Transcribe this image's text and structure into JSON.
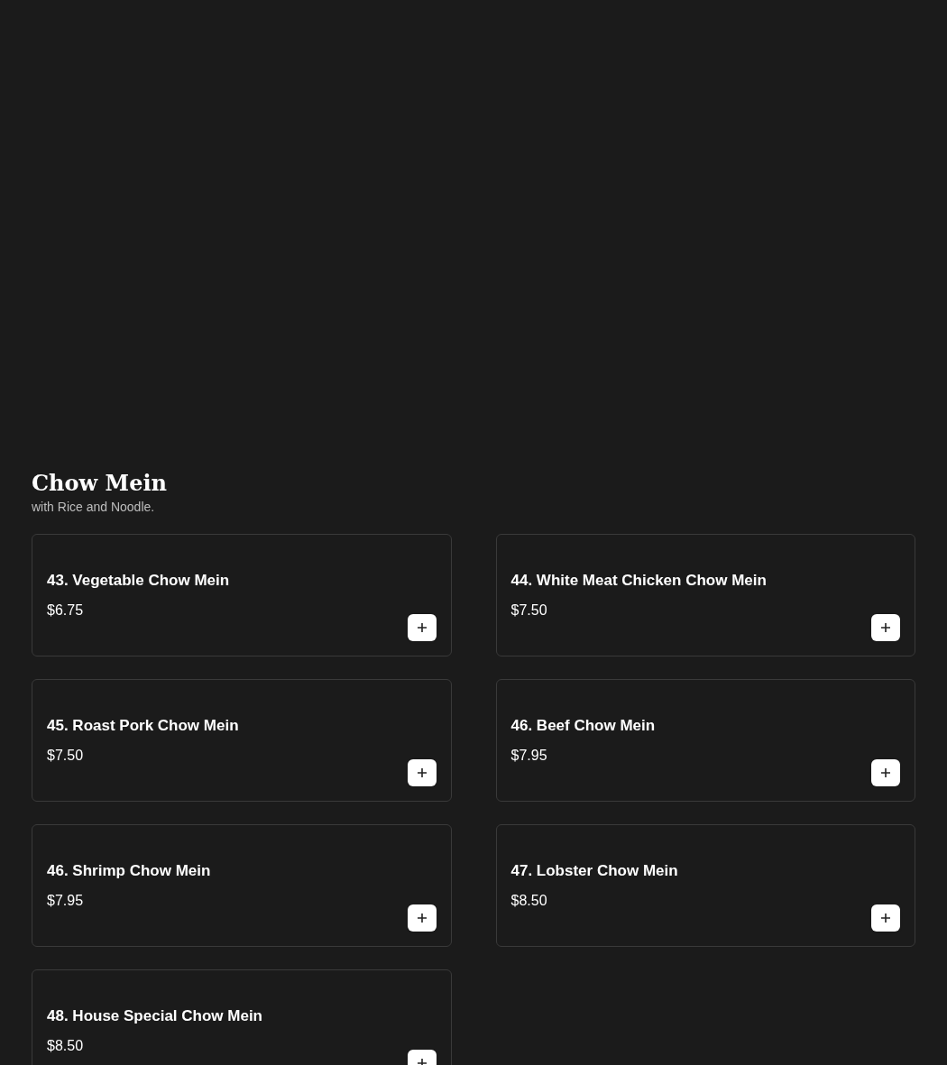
{
  "section": {
    "title": "Chow Mein",
    "subtitle": "with Rice and Noodle."
  },
  "items": [
    {
      "name": "43. Vegetable Chow Mein",
      "price": "$6.75"
    },
    {
      "name": "44. White Meat Chicken Chow Mein",
      "price": "$7.50"
    },
    {
      "name": "45. Roast Pork Chow Mein",
      "price": "$7.50"
    },
    {
      "name": "46. Beef Chow Mein",
      "price": "$7.95"
    },
    {
      "name": "46. Shrimp Chow Mein",
      "price": "$7.95"
    },
    {
      "name": "47. Lobster Chow Mein",
      "price": "$8.50"
    },
    {
      "name": "48. House Special Chow Mein",
      "price": "$8.50"
    }
  ]
}
